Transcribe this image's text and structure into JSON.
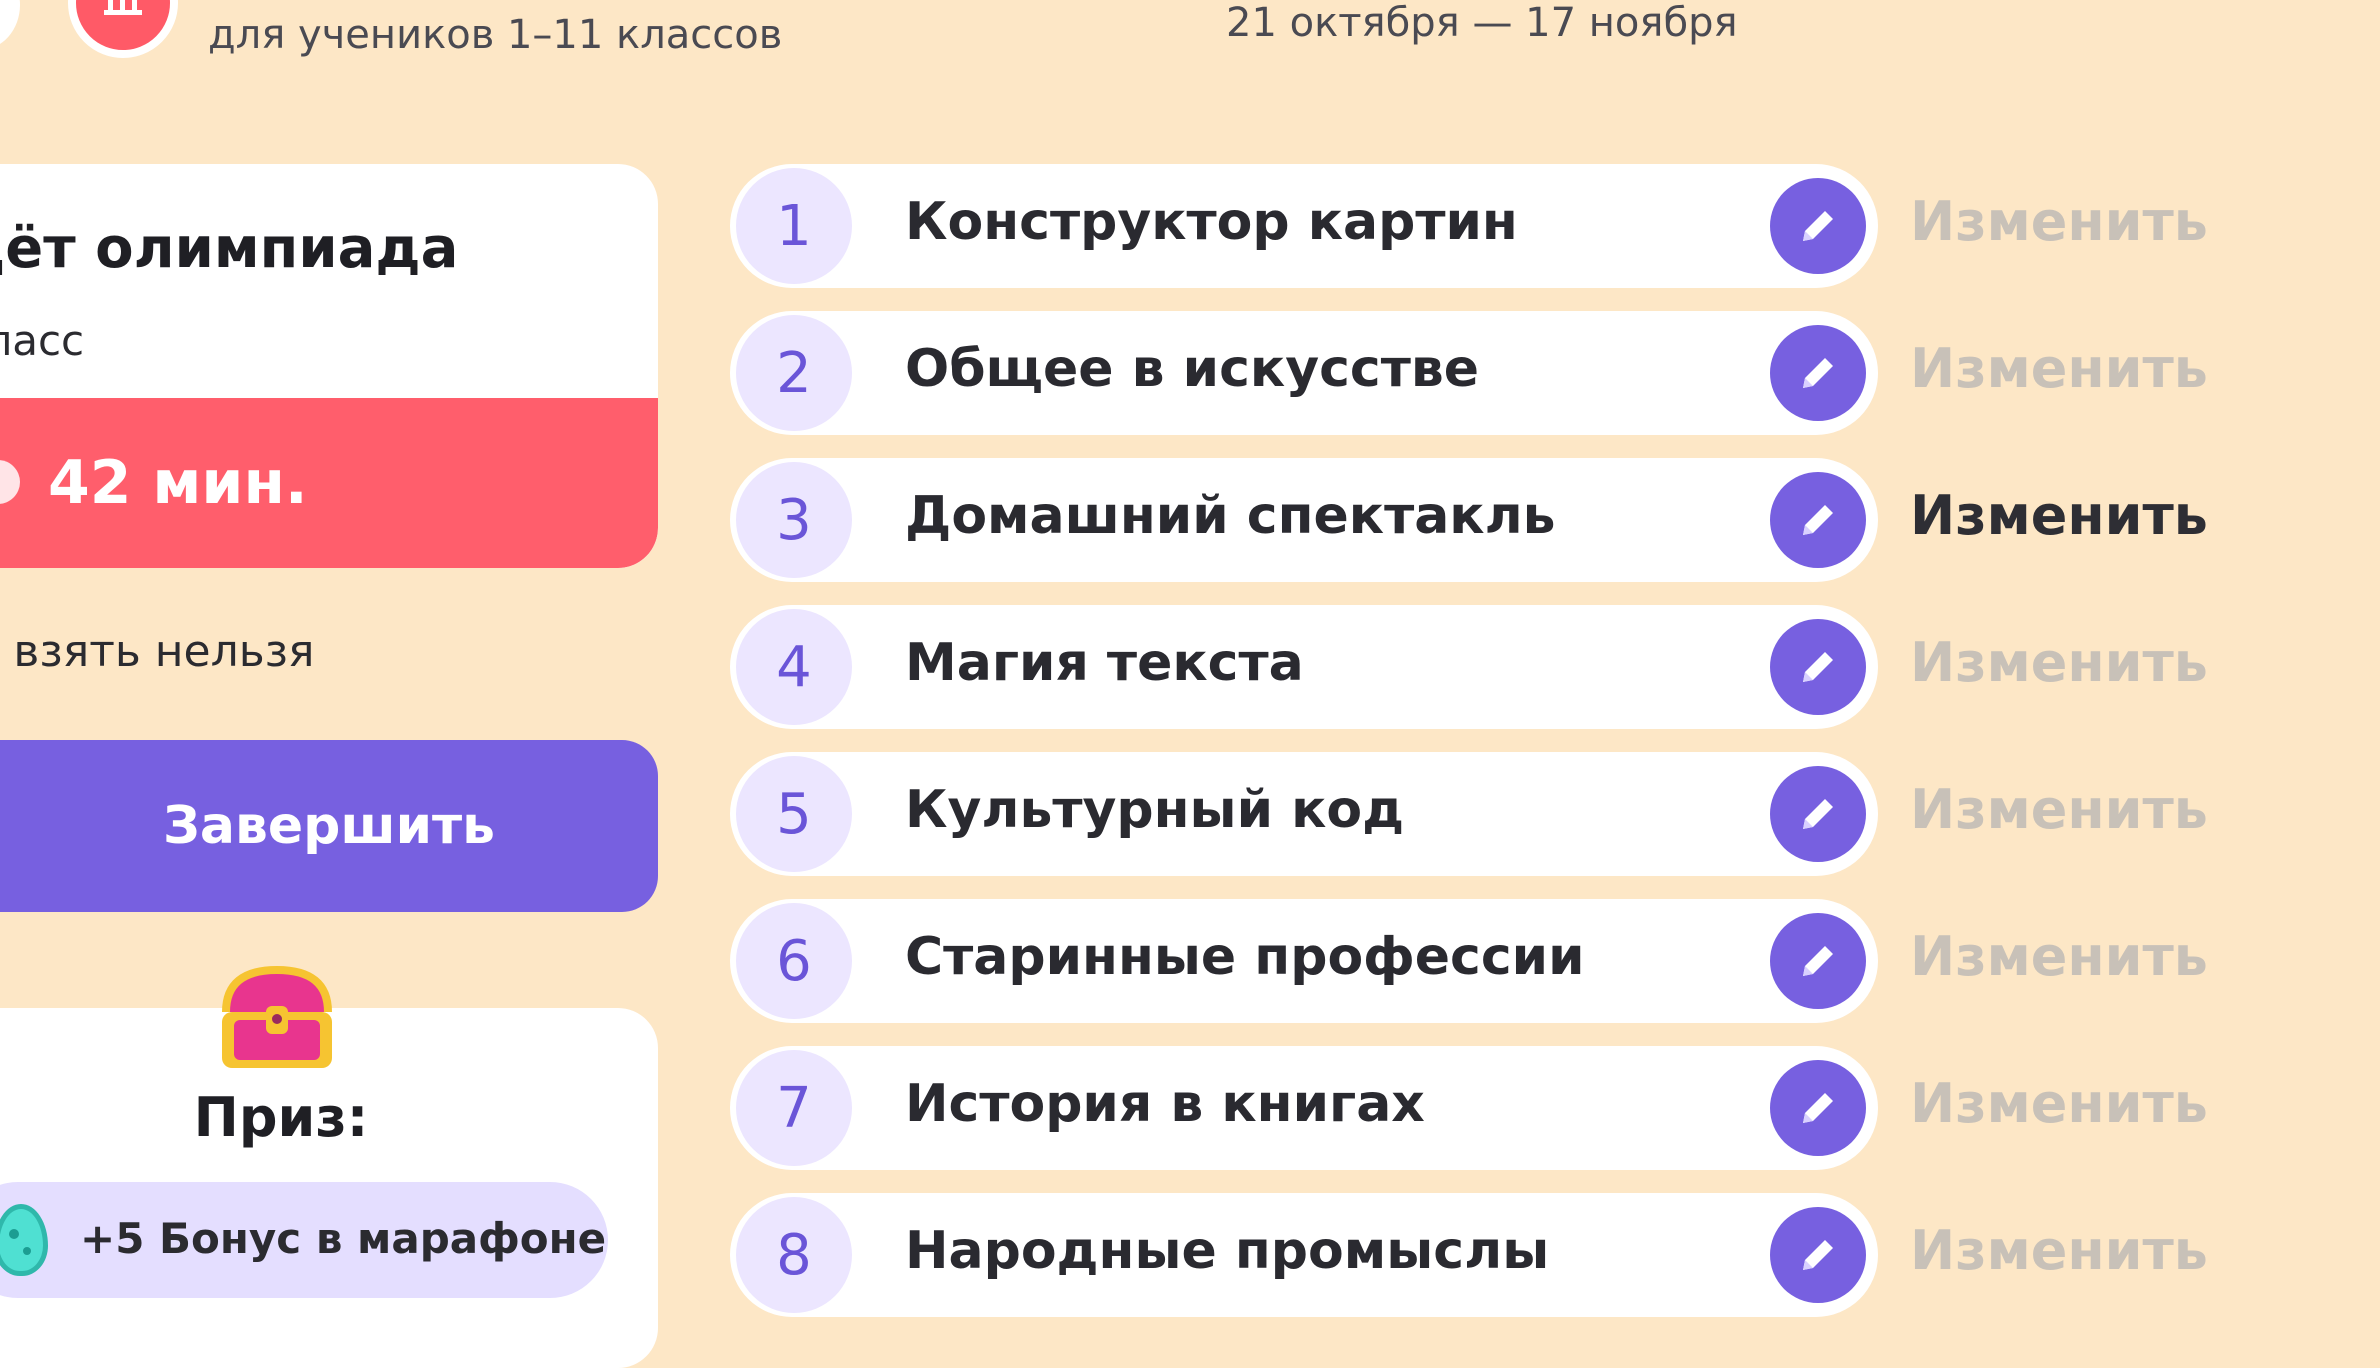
{
  "header": {
    "subtitle": "для учеников 1–11 классов",
    "dates": "21 октября — 17 ноября"
  },
  "status": {
    "title": "дёт олимпиада",
    "grade": "класс",
    "timer": "42 мин.",
    "warning": "зу взять нельзя",
    "finish_label": "Завершить"
  },
  "prize": {
    "label": "Приз:",
    "bonus": "+5 Бонус в марафоне"
  },
  "tasks": [
    {
      "number": "1",
      "title": "Конструктор картин",
      "action": "Изменить",
      "active": false
    },
    {
      "number": "2",
      "title": "Общее в искусстве",
      "action": "Изменить",
      "active": false
    },
    {
      "number": "3",
      "title": "Домашний спектакль",
      "action": "Изменить",
      "active": true
    },
    {
      "number": "4",
      "title": "Магия текста",
      "action": "Изменить",
      "active": false
    },
    {
      "number": "5",
      "title": "Культурный код",
      "action": "Изменить",
      "active": false
    },
    {
      "number": "6",
      "title": "Старинные профессии",
      "action": "Изменить",
      "active": false
    },
    {
      "number": "7",
      "title": "История в книгах",
      "action": "Изменить",
      "active": false
    },
    {
      "number": "8",
      "title": "Народные промыслы",
      "action": "Изменить",
      "active": false
    }
  ],
  "colors": {
    "background": "#FDE7C6",
    "accent": "#7760E0",
    "timer": "#FF5E6C",
    "pill": "#E4DEFF"
  },
  "icons": [
    "museum-icon",
    "clock-icon",
    "chest-icon",
    "egg-icon",
    "pencil-icon"
  ]
}
